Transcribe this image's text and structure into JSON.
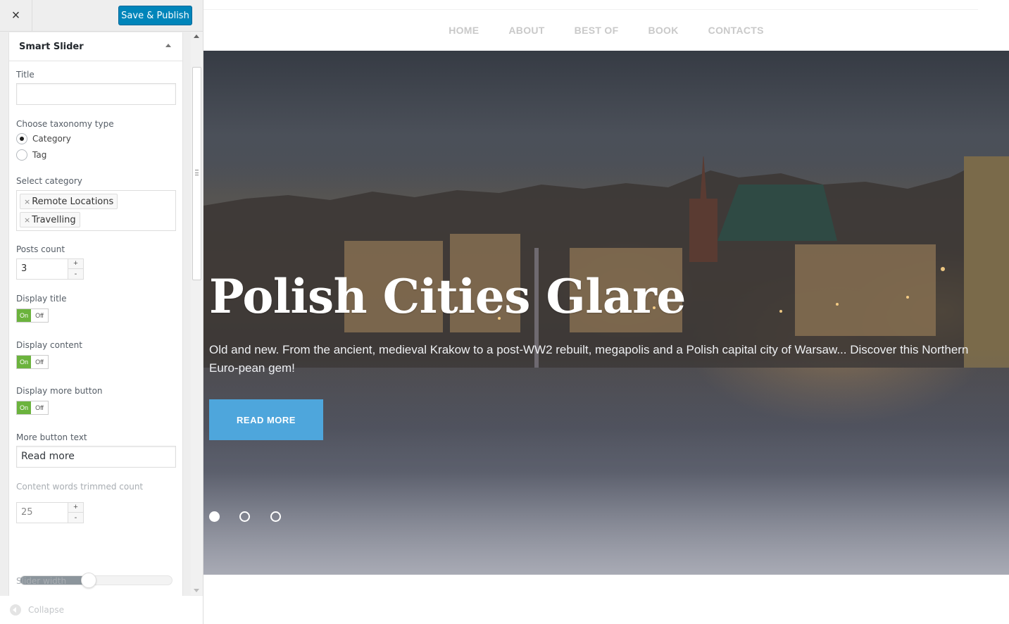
{
  "sidebar": {
    "close_symbol": "×",
    "save_label": "Save & Publish",
    "section_title": "Smart Slider",
    "title_label": "Title",
    "title_value": "",
    "taxonomy_label": "Choose taxonomy type",
    "taxonomy_options": [
      {
        "label": "Category",
        "checked": true
      },
      {
        "label": "Tag",
        "checked": false
      }
    ],
    "category_label": "Select category",
    "categories": [
      "Remote Locations",
      "Travelling"
    ],
    "chip_remove_symbol": "×",
    "posts_count_label": "Posts count",
    "posts_count": "3",
    "display_title_label": "Display title",
    "display_content_label": "Display content",
    "display_more_label": "Display more button",
    "toggle_on": "On",
    "toggle_off": "Off",
    "more_text_label": "More button text",
    "more_text_value": "Read more",
    "trim_label": "Content words trimmed count",
    "trim_value": "25",
    "stepper_plus": "+",
    "stepper_minus": "-",
    "slider_level": 0.45,
    "slider_width_label": "Slider width",
    "collapse_label": "Collapse"
  },
  "preview": {
    "nav": [
      "HOME",
      "ABOUT",
      "BEST OF",
      "BOOK",
      "CONTACTS"
    ],
    "slide_title": "Polish Cities Glare",
    "slide_content": "Old and new. From the ancient, medieval Krakow to a post-WW2 rebuilt, megapolis and a Polish capital city of Warsaw... Discover this Northern Euro-pean gem!",
    "read_more": "READ MORE",
    "dots": [
      true,
      false,
      false
    ]
  },
  "colors": {
    "primary_button": "#0085ba",
    "toggle_on": "#6bb33d",
    "read_more_button": "#4ea6dc"
  }
}
